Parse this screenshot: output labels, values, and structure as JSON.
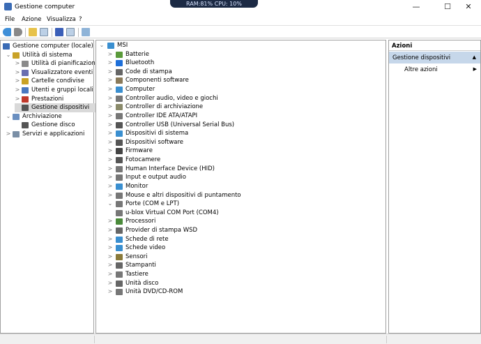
{
  "window": {
    "title": "Gestione computer",
    "overlay": "RAM:81%  CPU: 10%",
    "minimize": "—",
    "maximize": "☐",
    "close": "✕"
  },
  "menu": [
    "File",
    "Azione",
    "Visualizza",
    "?"
  ],
  "toolbar": [
    "back-icon",
    "forward-icon",
    "up-folder-icon",
    "show-hide-console-icon",
    "help-icon",
    "properties-icon",
    "monitor-icon"
  ],
  "left_tree": [
    {
      "label": "Gestione computer (locale)",
      "level": 0,
      "chev": "",
      "color": "#3a6bb5"
    },
    {
      "label": "Utilità di sistema",
      "level": 1,
      "chev": "⌄",
      "color": "#c9a227"
    },
    {
      "label": "Utilità di pianificazione",
      "level": 2,
      "chev": ">",
      "color": "#8a8a8a"
    },
    {
      "label": "Visualizzatore eventi",
      "level": 2,
      "chev": ">",
      "color": "#6b6fb0"
    },
    {
      "label": "Cartelle condivise",
      "level": 2,
      "chev": ">",
      "color": "#c9a227"
    },
    {
      "label": "Utenti e gruppi locali",
      "level": 2,
      "chev": ">",
      "color": "#4a78c0"
    },
    {
      "label": "Prestazioni",
      "level": 2,
      "chev": ">",
      "color": "#c0392b"
    },
    {
      "label": "Gestione dispositivi",
      "level": 2,
      "chev": "",
      "color": "#555",
      "selected": true
    },
    {
      "label": "Archiviazione",
      "level": 1,
      "chev": "⌄",
      "color": "#6a8fc0"
    },
    {
      "label": "Gestione disco",
      "level": 2,
      "chev": "",
      "color": "#555"
    },
    {
      "label": "Servizi e applicazioni",
      "level": 1,
      "chev": ">",
      "color": "#7a8fa6"
    }
  ],
  "device_root": "MSI",
  "devices": [
    {
      "label": "Batterie",
      "color": "#5a9a3a"
    },
    {
      "label": "Bluetooth",
      "color": "#1e6fd9"
    },
    {
      "label": "Code di stampa",
      "color": "#666"
    },
    {
      "label": "Componenti software",
      "color": "#8a7a5a"
    },
    {
      "label": "Computer",
      "color": "#3a8fd0"
    },
    {
      "label": "Controller audio, video e giochi",
      "color": "#777"
    },
    {
      "label": "Controller di archiviazione",
      "color": "#8a8a6a"
    },
    {
      "label": "Controller IDE ATA/ATAPI",
      "color": "#777"
    },
    {
      "label": "Controller USB (Universal Serial Bus)",
      "color": "#555"
    },
    {
      "label": "Dispositivi di sistema",
      "color": "#3a8fd0"
    },
    {
      "label": "Dispositivi software",
      "color": "#555"
    },
    {
      "label": "Firmware",
      "color": "#444"
    },
    {
      "label": "Fotocamere",
      "color": "#555"
    },
    {
      "label": "Human Interface Device (HID)",
      "color": "#777"
    },
    {
      "label": "Input e output audio",
      "color": "#777"
    },
    {
      "label": "Monitor",
      "color": "#3a8fd0"
    },
    {
      "label": "Mouse e altri dispositivi di puntamento",
      "color": "#777"
    },
    {
      "label": "Porte (COM e LPT)",
      "color": "#777",
      "expanded": true
    },
    {
      "label": "u-blox Virtual COM Port (COM4)",
      "color": "#777",
      "child": true
    },
    {
      "label": "Processori",
      "color": "#4a8a3a"
    },
    {
      "label": "Provider di stampa WSD",
      "color": "#666"
    },
    {
      "label": "Schede di rete",
      "color": "#3a8fd0"
    },
    {
      "label": "Schede video",
      "color": "#3a8fd0"
    },
    {
      "label": "Sensori",
      "color": "#8a7a3a"
    },
    {
      "label": "Stampanti",
      "color": "#666"
    },
    {
      "label": "Tastiere",
      "color": "#777"
    },
    {
      "label": "Unità disco",
      "color": "#666"
    },
    {
      "label": "Unità DVD/CD-ROM",
      "color": "#777"
    }
  ],
  "actions": {
    "header": "Azioni",
    "section": "Gestione dispositivi",
    "section_arrow": "▲",
    "item": "Altre azioni",
    "item_arrow": "▶"
  }
}
